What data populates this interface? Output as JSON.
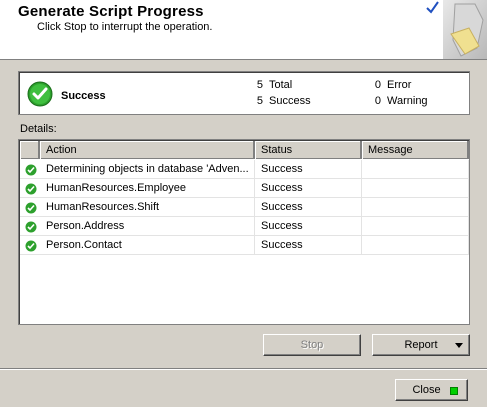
{
  "header": {
    "title": "Generate Script Progress",
    "subtitle": "Click Stop to interrupt the operation."
  },
  "summary": {
    "status_label": "Success",
    "total_count": "5",
    "total_label": "Total",
    "success_count": "5",
    "success_label": "Success",
    "error_count": "0",
    "error_label": "Error",
    "warning_count": "0",
    "warning_label": "Warning"
  },
  "details": {
    "label": "Details:",
    "columns": [
      "Action",
      "Status",
      "Message"
    ],
    "rows": [
      {
        "action": "Determining objects in database 'Adven...",
        "status": "Success",
        "message": ""
      },
      {
        "action": "HumanResources.Employee",
        "status": "Success",
        "message": ""
      },
      {
        "action": "HumanResources.Shift",
        "status": "Success",
        "message": ""
      },
      {
        "action": "Person.Address",
        "status": "Success",
        "message": ""
      },
      {
        "action": "Person.Contact",
        "status": "Success",
        "message": ""
      }
    ]
  },
  "buttons": {
    "stop": "Stop",
    "report": "Report",
    "close": "Close"
  },
  "colors": {
    "success": "#2da02d",
    "close_indicator": "#00d000"
  },
  "icons": {
    "status": "success-check-icon",
    "row": "success-check-icon",
    "report_dropdown": "chevron-down-icon"
  }
}
